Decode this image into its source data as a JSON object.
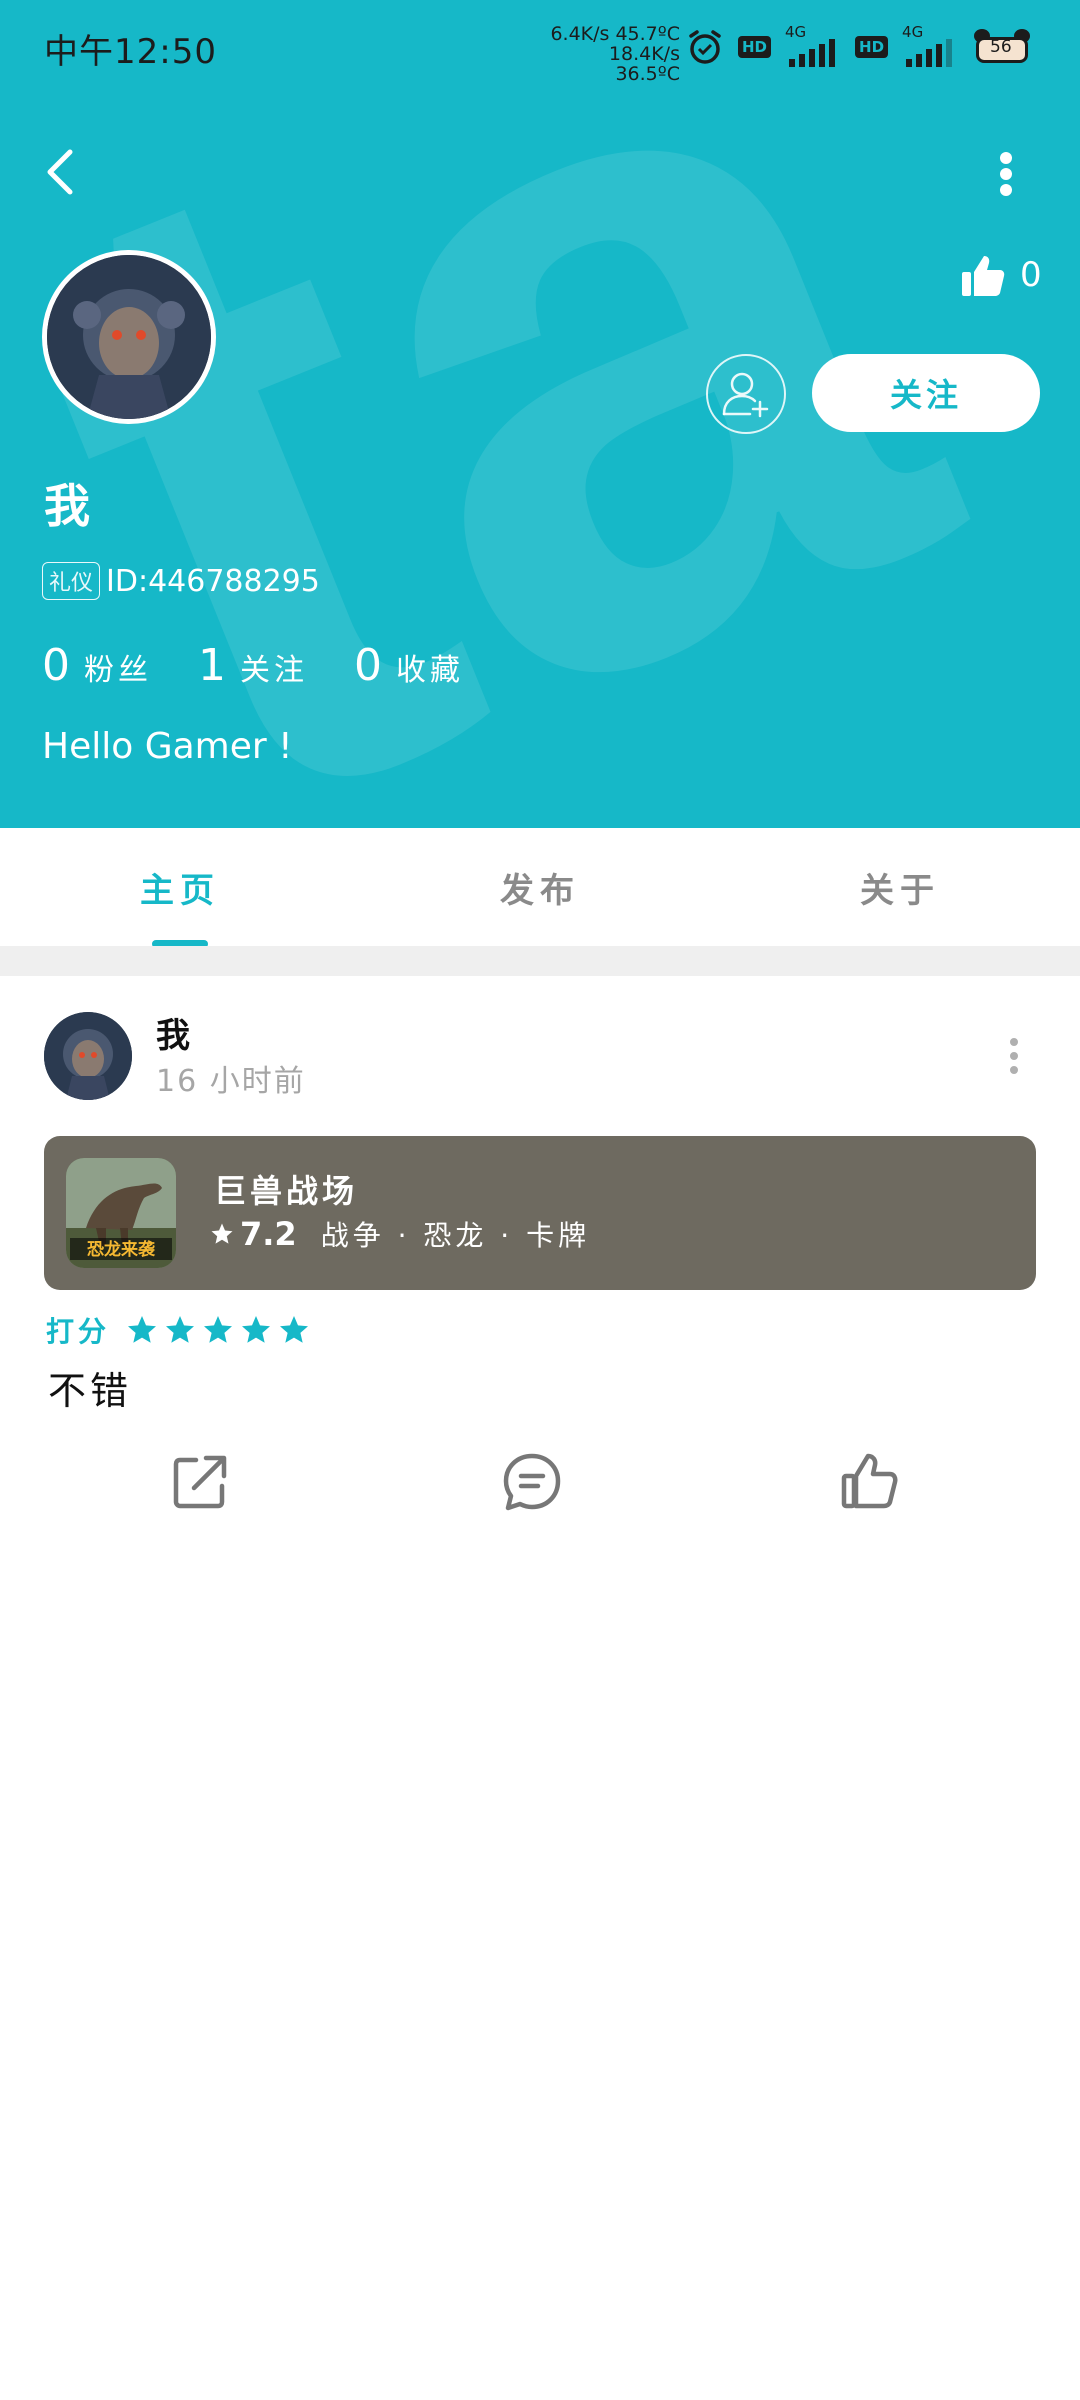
{
  "status_bar": {
    "time": "中午12:50",
    "net_speed_line1": "6.4K/s 45.7ºC",
    "net_speed_line2": "18.4K/s 36.5ºC",
    "network_type_1": "4G",
    "network_type_2": "4G",
    "hd_label_1": "HD",
    "hd_label_2": "HD",
    "battery_level": "56"
  },
  "profile": {
    "like_count": "0",
    "follow_button_label": "关注",
    "username": "我",
    "badge": "礼仪",
    "user_id": "ID:446788295",
    "stats": [
      {
        "count": "0",
        "label": "粉丝"
      },
      {
        "count": "1",
        "label": "关注"
      },
      {
        "count": "0",
        "label": "收藏"
      }
    ],
    "bio": "Hello Gamer !"
  },
  "tabs": [
    {
      "label": "主页",
      "active": true
    },
    {
      "label": "发布",
      "active": false
    },
    {
      "label": "关于",
      "active": false
    }
  ],
  "post": {
    "author": "我",
    "time": "16 小时前",
    "game": {
      "name": "巨兽战场",
      "score": "7.2",
      "tags": "战争 · 恐龙 · 卡牌",
      "icon_text": "恐龙来袭"
    },
    "rating_label": "打分",
    "rating_stars": 5,
    "review": "不错"
  },
  "colors": {
    "accent": "#16b8c8",
    "card_bg": "#6e6a60",
    "muted": "#a6a6a6"
  },
  "icons": {
    "back": "chevron-left-icon",
    "more": "more-vertical-icon",
    "like": "thumbs-up-icon",
    "add_friend": "user-plus-icon",
    "share": "share-icon",
    "comment": "comment-icon",
    "star": "star-icon"
  }
}
